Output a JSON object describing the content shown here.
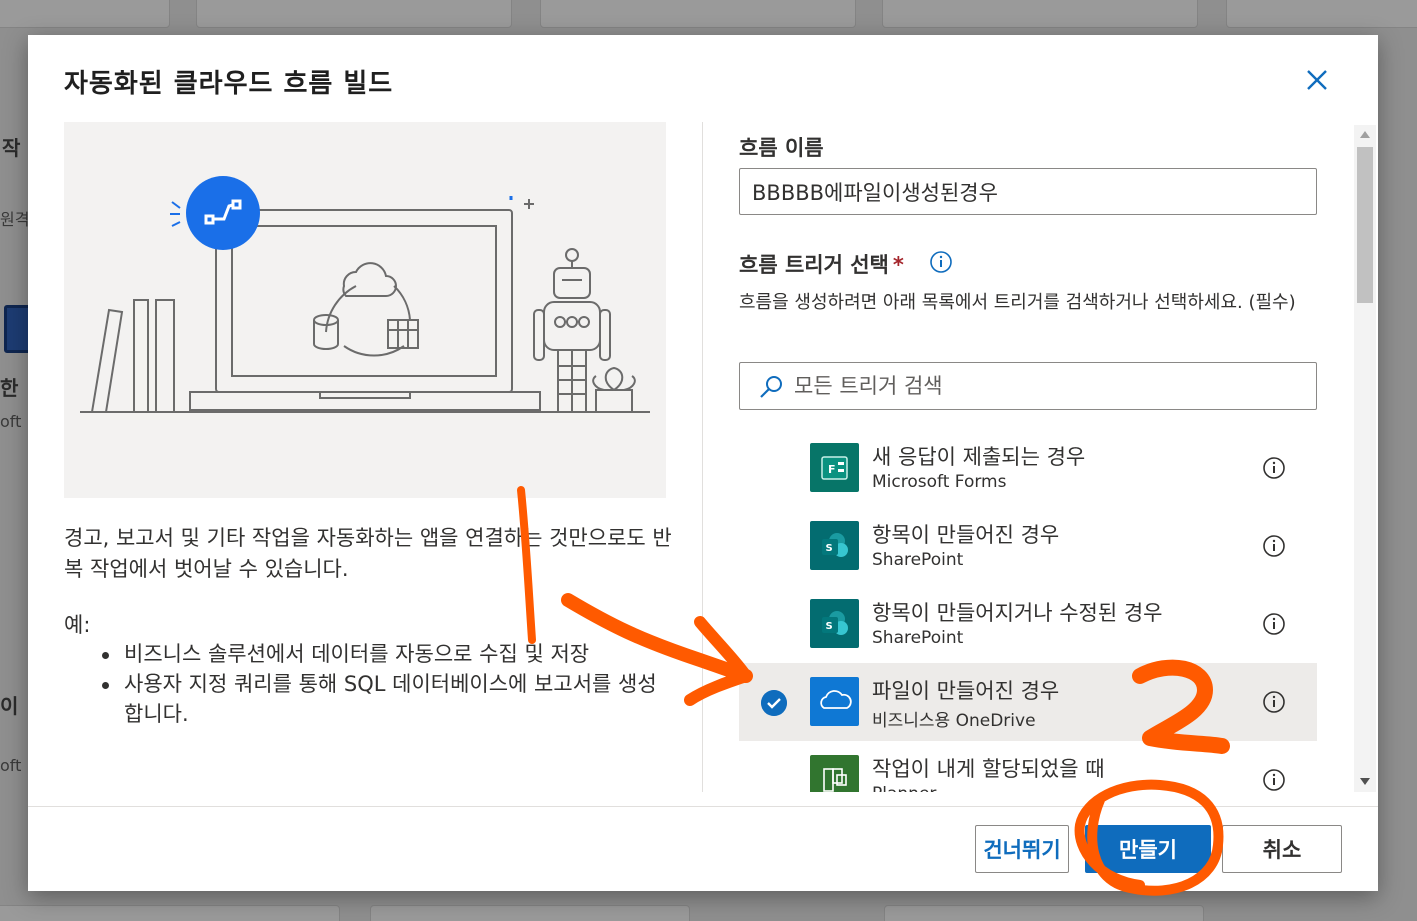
{
  "background": {
    "fragments": [
      "작",
      "원격",
      "한",
      "oft",
      "이",
      "oft"
    ]
  },
  "dialog": {
    "title": "자동화된 클라우드 흐름 빌드",
    "description": "경고, 보고서 및 기타 작업을 자동화하는 앱을 연결하는 것만으로도 반복 작업에서 벗어날 수 있습니다.",
    "example_label": "예:",
    "examples": [
      "비즈니스 솔루션에서 데이터를 자동으로 수집 및 저장",
      "사용자 지정 쿼리를 통해 SQL 데이터베이스에 보고서를 생성합니다."
    ],
    "flow_name_label": "흐름 이름",
    "flow_name_value": "BBBBB에파일이생성된경우",
    "trigger_label": "흐름 트리거 선택",
    "required_mark": "*",
    "trigger_help": "흐름을 생성하려면 아래 목록에서 트리거를 검색하거나 선택하세요. (필수)",
    "search_placeholder": "모든 트리거 검색",
    "triggers": [
      {
        "title": "새 응답이 제출되는 경우",
        "subtitle": "Microsoft Forms",
        "icon": "forms-icon",
        "color": "#077568",
        "selected": false
      },
      {
        "title": "항목이 만들어진 경우",
        "subtitle": "SharePoint",
        "icon": "sharepoint-icon",
        "color": "#036c70",
        "selected": false
      },
      {
        "title": "항목이 만들어지거나 수정된 경우",
        "subtitle": "SharePoint",
        "icon": "sharepoint-icon",
        "color": "#036c70",
        "selected": false
      },
      {
        "title": "파일이 만들어진 경우",
        "subtitle": "비즈니스용 OneDrive",
        "icon": "onedrive-icon",
        "color": "#0f78d4",
        "selected": true
      },
      {
        "title": "작업이 내게 할당되었을 때",
        "subtitle": "Planner",
        "icon": "planner-icon",
        "color": "#31752f",
        "selected": false
      }
    ],
    "buttons": {
      "skip": "건너뛰기",
      "create": "만들기",
      "cancel": "취소"
    }
  },
  "annotations": {
    "color": "#ff5a00",
    "step2": "2"
  },
  "colors": {
    "accent": "#0f6cbd",
    "illustration_blue": "#1a6fe8"
  }
}
